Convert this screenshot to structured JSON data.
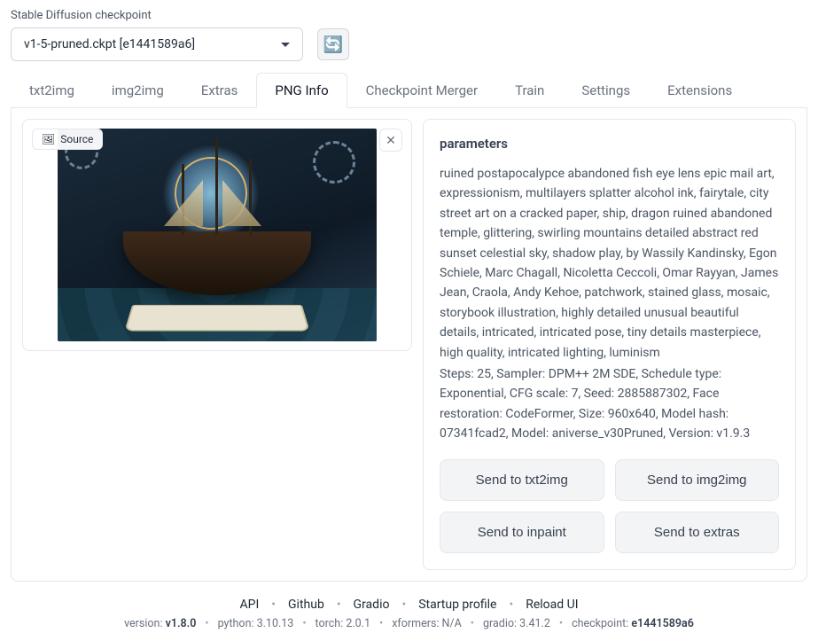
{
  "checkpoint": {
    "label": "Stable Diffusion checkpoint",
    "value": "v1-5-pruned.ckpt [e1441589a6]"
  },
  "tabs": [
    {
      "label": "txt2img",
      "active": false
    },
    {
      "label": "img2img",
      "active": false
    },
    {
      "label": "Extras",
      "active": false
    },
    {
      "label": "PNG Info",
      "active": true
    },
    {
      "label": "Checkpoint Merger",
      "active": false
    },
    {
      "label": "Train",
      "active": false
    },
    {
      "label": "Settings",
      "active": false
    },
    {
      "label": "Extensions",
      "active": false
    }
  ],
  "source_badge": "Source",
  "params": {
    "heading": "parameters",
    "prompt": "ruined postapocalypce abandoned fish eye lens epic mail art, expressionism, multilayers splatter alcohol ink, fairytale, city street art on a cracked paper, ship, dragon ruined abandoned temple, glittering, swirling mountains detailed abstract red sunset celestial sky, shadow play, by Wassily Kandinsky, Egon Schiele, Marc Chagall, Nicoletta Ceccoli, Omar Rayyan, James Jean, Craola, Andy Kehoe, patchwork, stained glass, mosaic, storybook illustration, highly detailed unusual beautiful details, intricated, intricated pose, tiny details masterpiece, high quality, intricated lighting, luminism",
    "generation": "Steps: 25, Sampler: DPM++ 2M SDE, Schedule type: Exponential, CFG scale: 7, Seed: 2885887302, Face restoration: CodeFormer, Size: 960x640, Model hash: 07341fcad2, Model: aniverse_v30Pruned, Version: v1.9.3"
  },
  "buttons": {
    "txt2img": "Send to txt2img",
    "img2img": "Send to img2img",
    "inpaint": "Send to inpaint",
    "extras": "Send to extras"
  },
  "footer": {
    "links": [
      "API",
      "Github",
      "Gradio",
      "Startup profile",
      "Reload UI"
    ],
    "version_label": "version: ",
    "version": "v1.8.0",
    "python_label": "python: ",
    "python": "3.10.13",
    "torch_label": "torch: ",
    "torch": "2.0.1",
    "xformers_label": "xformers: ",
    "xformers": "N/A",
    "gradio_label": "gradio: ",
    "gradio": "3.41.2",
    "checkpoint_label": "checkpoint: ",
    "checkpoint": "e1441589a6"
  }
}
